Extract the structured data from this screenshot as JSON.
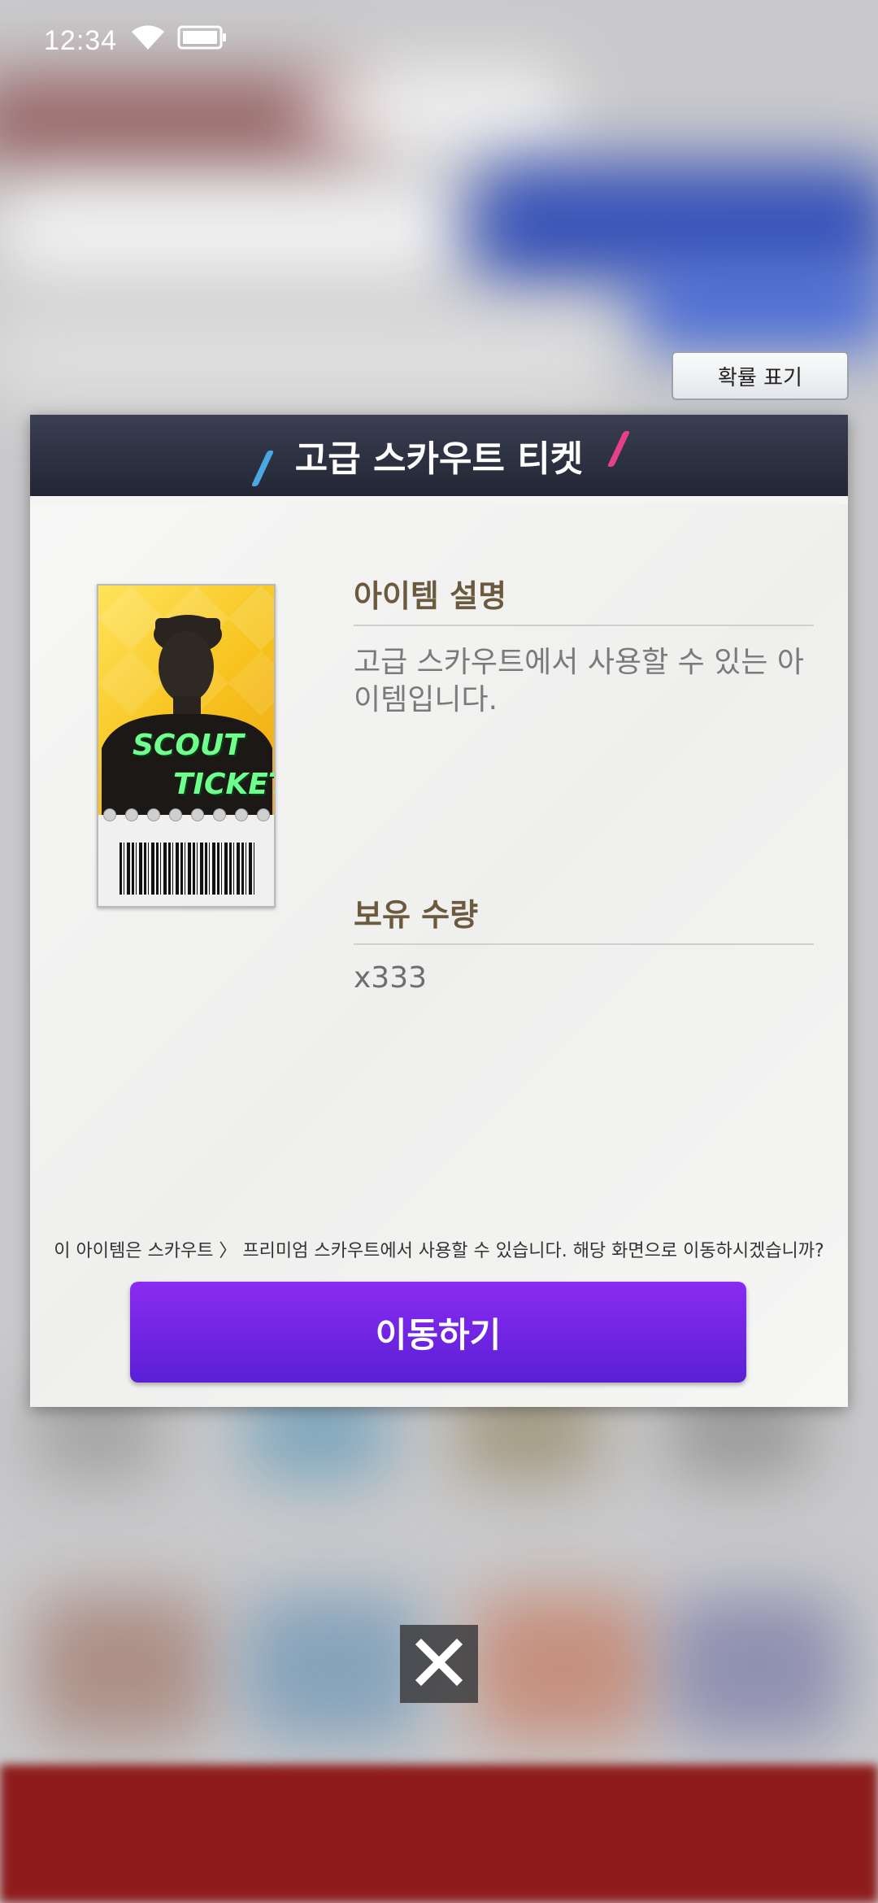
{
  "status_bar": {
    "time": "12:34"
  },
  "probability_button": {
    "label": "확률 표기"
  },
  "dialog": {
    "title": "고급 스카우트 티켓",
    "ticket_image": {
      "line1": "SCOUT",
      "line2": "TICKET"
    },
    "description_title": "아이템 설명",
    "description_text": "고급 스카우트에서 사용할 수 있는 아이템입니다.",
    "quantity_title": "보유 수량",
    "quantity_value": "x333",
    "notice": "이 아이템은 스카우트 〉 프리미엄 스카우트에서 사용할 수 있습니다. 해당 화면으로 이동하시겠습니까?",
    "move_button": "이동하기"
  },
  "close_button": {
    "icon": "close-icon"
  },
  "colors": {
    "header_bg": "#262a38",
    "accent_purple": "#7a25ea",
    "section_title": "#6b5a3e",
    "slash_blue": "#4aa8e0",
    "slash_pink": "#e6408a"
  }
}
